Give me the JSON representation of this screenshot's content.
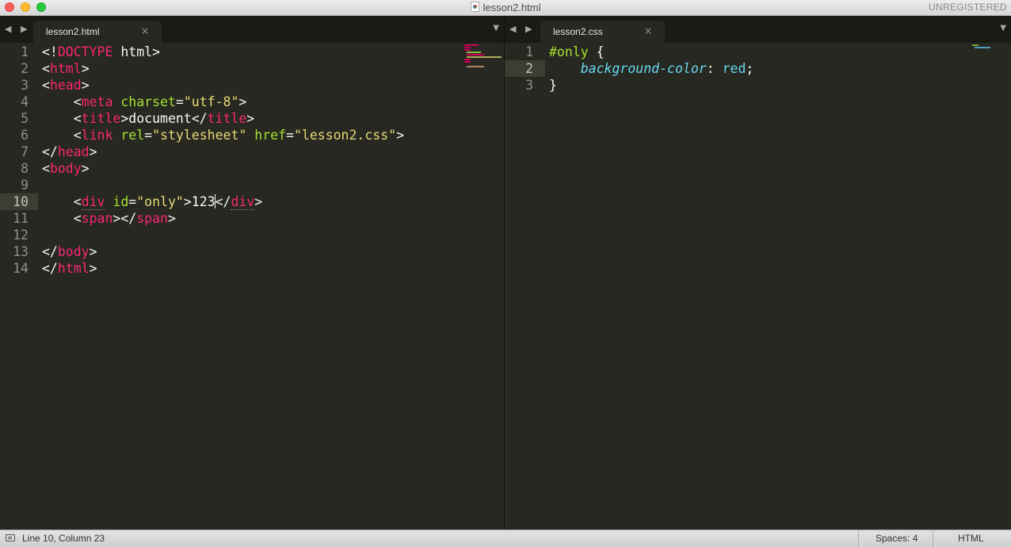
{
  "window": {
    "title": "lesson2.html",
    "badge": "UNREGISTERED"
  },
  "left_group": {
    "tab_label": "lesson2.html",
    "tab_close": "×",
    "lines": [
      {
        "no": "1",
        "tokens": [
          [
            "t",
            "<!"
          ],
          [
            "tg",
            "DOCTYPE"
          ],
          [
            "t",
            " html>"
          ]
        ]
      },
      {
        "no": "2",
        "tokens": [
          [
            "t",
            "<"
          ],
          [
            "tg",
            "html"
          ],
          [
            "t",
            ">"
          ]
        ]
      },
      {
        "no": "3",
        "tokens": [
          [
            "t",
            "<"
          ],
          [
            "tg",
            "head"
          ],
          [
            "t",
            ">"
          ]
        ]
      },
      {
        "no": "4",
        "tokens": [
          [
            "t",
            "    <"
          ],
          [
            "tg",
            "meta"
          ],
          [
            "t",
            " "
          ],
          [
            "at",
            "charset"
          ],
          [
            "t",
            "="
          ],
          [
            "st",
            "\"utf-8\""
          ],
          [
            "t",
            ">"
          ]
        ]
      },
      {
        "no": "5",
        "tokens": [
          [
            "t",
            "    <"
          ],
          [
            "tg",
            "title"
          ],
          [
            "t",
            ">document</"
          ],
          [
            "tg",
            "title"
          ],
          [
            "t",
            ">"
          ]
        ]
      },
      {
        "no": "6",
        "tokens": [
          [
            "t",
            "    <"
          ],
          [
            "tg",
            "link"
          ],
          [
            "t",
            " "
          ],
          [
            "at",
            "rel"
          ],
          [
            "t",
            "="
          ],
          [
            "st",
            "\"stylesheet\""
          ],
          [
            "t",
            " "
          ],
          [
            "at",
            "href"
          ],
          [
            "t",
            "="
          ],
          [
            "st",
            "\"lesson2.css\""
          ],
          [
            "t",
            ">"
          ]
        ]
      },
      {
        "no": "7",
        "tokens": [
          [
            "t",
            "</"
          ],
          [
            "tg",
            "head"
          ],
          [
            "t",
            ">"
          ]
        ]
      },
      {
        "no": "8",
        "tokens": [
          [
            "t",
            "<"
          ],
          [
            "tg",
            "body"
          ],
          [
            "t",
            ">"
          ]
        ]
      },
      {
        "no": "9",
        "tokens": []
      },
      {
        "no": "10",
        "tokens": [
          [
            "t",
            "    <"
          ],
          [
            "tgd",
            "div"
          ],
          [
            "t",
            " "
          ],
          [
            "at",
            "id"
          ],
          [
            "t",
            "="
          ],
          [
            "st",
            "\"only\""
          ],
          [
            "t",
            ">123"
          ],
          [
            "cur",
            ""
          ],
          [
            "t",
            "</"
          ],
          [
            "tgd",
            "div"
          ],
          [
            "t",
            ">"
          ]
        ]
      },
      {
        "no": "11",
        "tokens": [
          [
            "t",
            "    <"
          ],
          [
            "tg",
            "span"
          ],
          [
            "t",
            "></"
          ],
          [
            "tg",
            "span"
          ],
          [
            "t",
            ">"
          ]
        ]
      },
      {
        "no": "12",
        "tokens": []
      },
      {
        "no": "13",
        "tokens": [
          [
            "t",
            "</"
          ],
          [
            "tg",
            "body"
          ],
          [
            "t",
            ">"
          ]
        ]
      },
      {
        "no": "14",
        "tokens": [
          [
            "t",
            "</"
          ],
          [
            "tg",
            "html"
          ],
          [
            "t",
            ">"
          ]
        ]
      }
    ],
    "active_line": 10
  },
  "right_group": {
    "tab_label": "lesson2.css",
    "tab_close": "×",
    "lines": [
      {
        "no": "1",
        "tokens": [
          [
            "sel",
            "#only"
          ],
          [
            "t",
            " {"
          ]
        ]
      },
      {
        "no": "2",
        "tokens": [
          [
            "t",
            "    "
          ],
          [
            "pr",
            "background-color"
          ],
          [
            "t",
            ": "
          ],
          [
            "pr2",
            "red"
          ],
          [
            "t",
            ";"
          ]
        ]
      },
      {
        "no": "3",
        "tokens": [
          [
            "t",
            "}"
          ]
        ]
      }
    ],
    "active_line": 2
  },
  "statusbar": {
    "position": "Line 10, Column 23",
    "indentation": "Spaces: 4",
    "syntax": "HTML"
  },
  "icons": {
    "nav_arrows": "◀ ▶",
    "dropdown": "▼"
  }
}
